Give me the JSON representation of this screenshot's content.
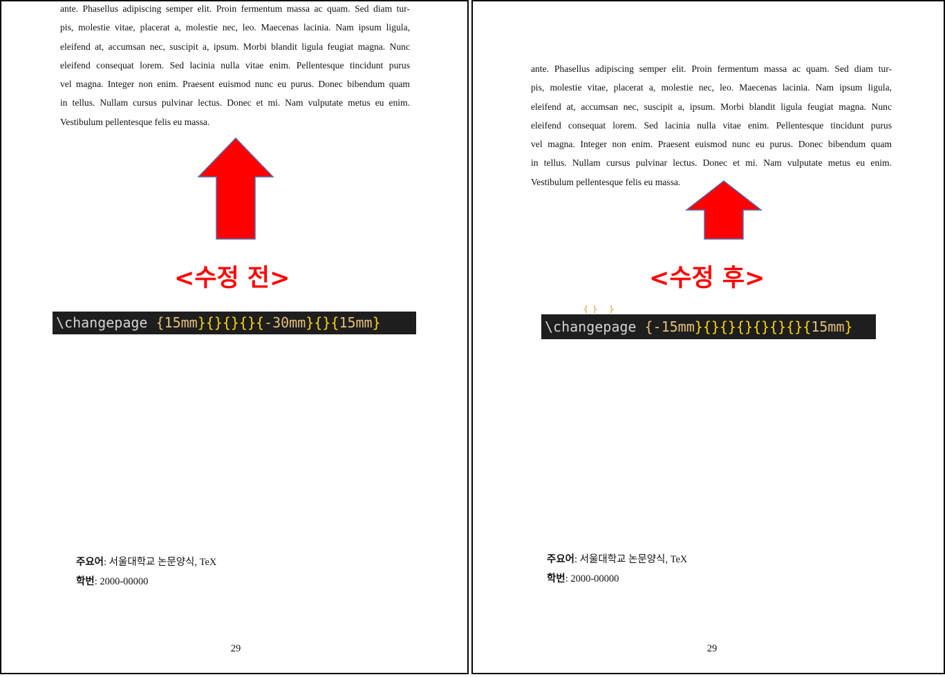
{
  "body_lines": [
    "ante. Phasellus adipiscing semper elit. Proin fermentum massa ac quam. Sed diam tur-",
    "pis, molestie vitae, placerat a, molestie nec, leo. Maecenas lacinia. Nam ipsum ligula,",
    "eleifend at, accumsan nec, suscipit a, ipsum. Morbi blandit ligula feugiat magna. Nunc",
    "eleifend consequat lorem. Sed lacinia nulla vitae enim. Pellentesque tincidunt purus",
    "vel magna. Integer non enim. Praesent euismod nunc eu purus. Donec bibendum quam",
    "in tellus. Nullam cursus pulvinar lectus. Donec et mi. Nam vulputate metus eu enim.",
    "Vestibulum pellentesque felis eu massa."
  ],
  "left": {
    "caption": "<수정 전>",
    "code_cmd": "\\changepage",
    "code_arg1": "{15mm",
    "code_mid1": "}{}{}{}{",
    "code_arg2": "-30mm",
    "code_mid2": "}{}{",
    "code_arg3": "15mm",
    "code_end": "}"
  },
  "right": {
    "caption": "<수정 후>",
    "code_cmd": "\\changepage",
    "code_arg1": "{-15mm",
    "code_mid1": "}{}{}{}{}{}{}{",
    "code_arg3": "15mm",
    "code_end": "}"
  },
  "keywords_label": "주요어",
  "keywords_value": ": 서울대학교 논문양식, TeX",
  "student_id_label": "학번",
  "student_id_value": ": 2000-00000",
  "page_number": "29",
  "colors": {
    "arrow_fill": "#ff0000",
    "arrow_stroke": "#4f6fb0",
    "caption": "#ff0000",
    "code_bg": "#1e1e1e"
  }
}
